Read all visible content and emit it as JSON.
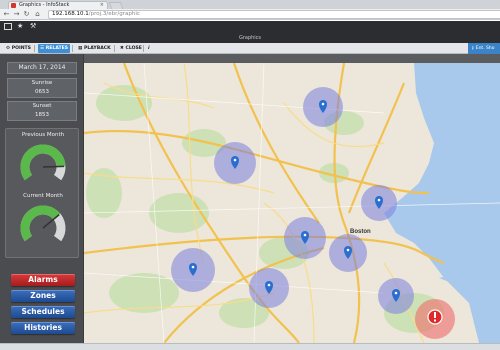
{
  "browser": {
    "tab_title": "Graphics - InfoStack",
    "url_host": "192.168.10.1",
    "url_path": "/proj.3/ebr/graphic"
  },
  "app": {
    "title": "Graphics"
  },
  "menu": {
    "points": "POINTS",
    "relates": "RELATES",
    "playback": "PLAYBACK",
    "close": "CLOSE",
    "info": "i",
    "right_button": "Ent. Sho"
  },
  "sidebar": {
    "date": "March 17, 2014",
    "sunrise_label": "Sunrise",
    "sunrise_value": "0653",
    "sunset_label": "Sunset",
    "sunset_value": "1853",
    "previous_month_label": "Previous Month",
    "current_month_label": "Current Month",
    "previous_month_level": 0.85,
    "current_month_level": 0.7,
    "buttons": {
      "alarms": "Alarms",
      "zones": "Zones",
      "schedules": "Schedules",
      "histories": "Histories"
    }
  },
  "map": {
    "labels": {
      "boston": "Boston"
    },
    "alarm_icon": "alert-icon",
    "colors": {
      "zone_fill": "#7b7fe0",
      "alarm_fill": "#f06a6a",
      "pin": "#2a6fd0"
    }
  }
}
